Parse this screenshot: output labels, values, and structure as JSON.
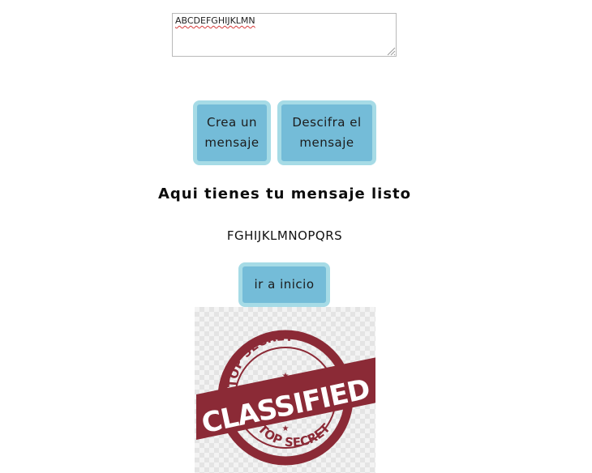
{
  "input": {
    "value": "ABCDEFGHIJKLMN"
  },
  "buttons": {
    "create_label": "Crea un mensaje",
    "decipher_label": "Descifra el mensaje",
    "home_label": "ir a inicio"
  },
  "heading": "Aqui tienes tu mensaje listo",
  "result": "FGHIJKLMNOPQRS",
  "stamp": {
    "top_text": "TOP SECRET",
    "main_text": "CLASSIFIED",
    "bottom_text": "TOP SECRET",
    "color": "#8b2a36"
  },
  "colors": {
    "button_bg": "#74bcd8",
    "button_border": "#a6dbe6"
  }
}
